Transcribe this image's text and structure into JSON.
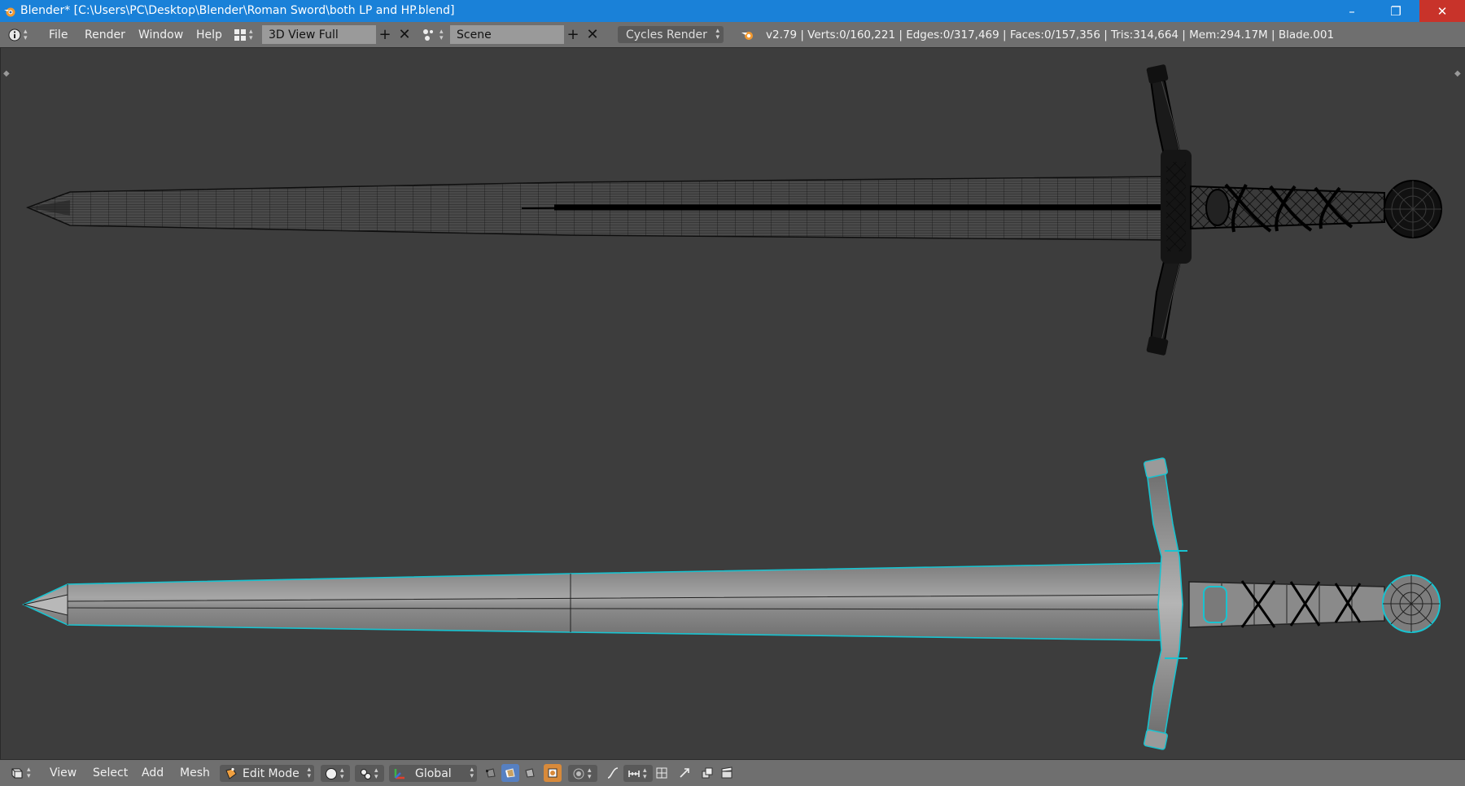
{
  "window": {
    "title": "Blender* [C:\\Users\\PC\\Desktop\\Blender\\Roman Sword\\both LP and HP.blend]",
    "minimize_glyph": "–",
    "maximize_glyph": "❐",
    "close_glyph": "✕"
  },
  "infobar": {
    "menus": [
      "File",
      "Render",
      "Window",
      "Help"
    ],
    "screen_layout": "3D View Full",
    "scene": "Scene",
    "render_engine": "Cycles Render",
    "stats": "v2.79 | Verts:0/160,221 | Edges:0/317,469 | Faces:0/157,356 | Tris:314,664 | Mem:294.17M | Blade.001"
  },
  "footer": {
    "menus": [
      "View",
      "Select",
      "Add",
      "Mesh"
    ],
    "mode": "Edit Mode",
    "orientation": "Global"
  },
  "icons": [
    "blender-logo-icon",
    "info-icon",
    "screen-layout-icon",
    "add-icon",
    "close-icon",
    "scene-icon",
    "render-icon",
    "view3d-icon",
    "edit-mode-icon",
    "shading-icon",
    "pivot-icon",
    "manipulator-icon",
    "vertex-select-icon",
    "edge-select-icon",
    "face-select-icon",
    "occlude-icon",
    "proportional-icon",
    "snap-icon",
    "snap-target-icon",
    "copy-layers-icon",
    "clapboard-icon"
  ],
  "colors": {
    "titlebar": "#1a81d8",
    "header": "#6f6f6f",
    "viewport": "#3d3d3d",
    "selection": "#18c3d0",
    "wire": "#000000",
    "mesh": "#8f8f8f"
  }
}
